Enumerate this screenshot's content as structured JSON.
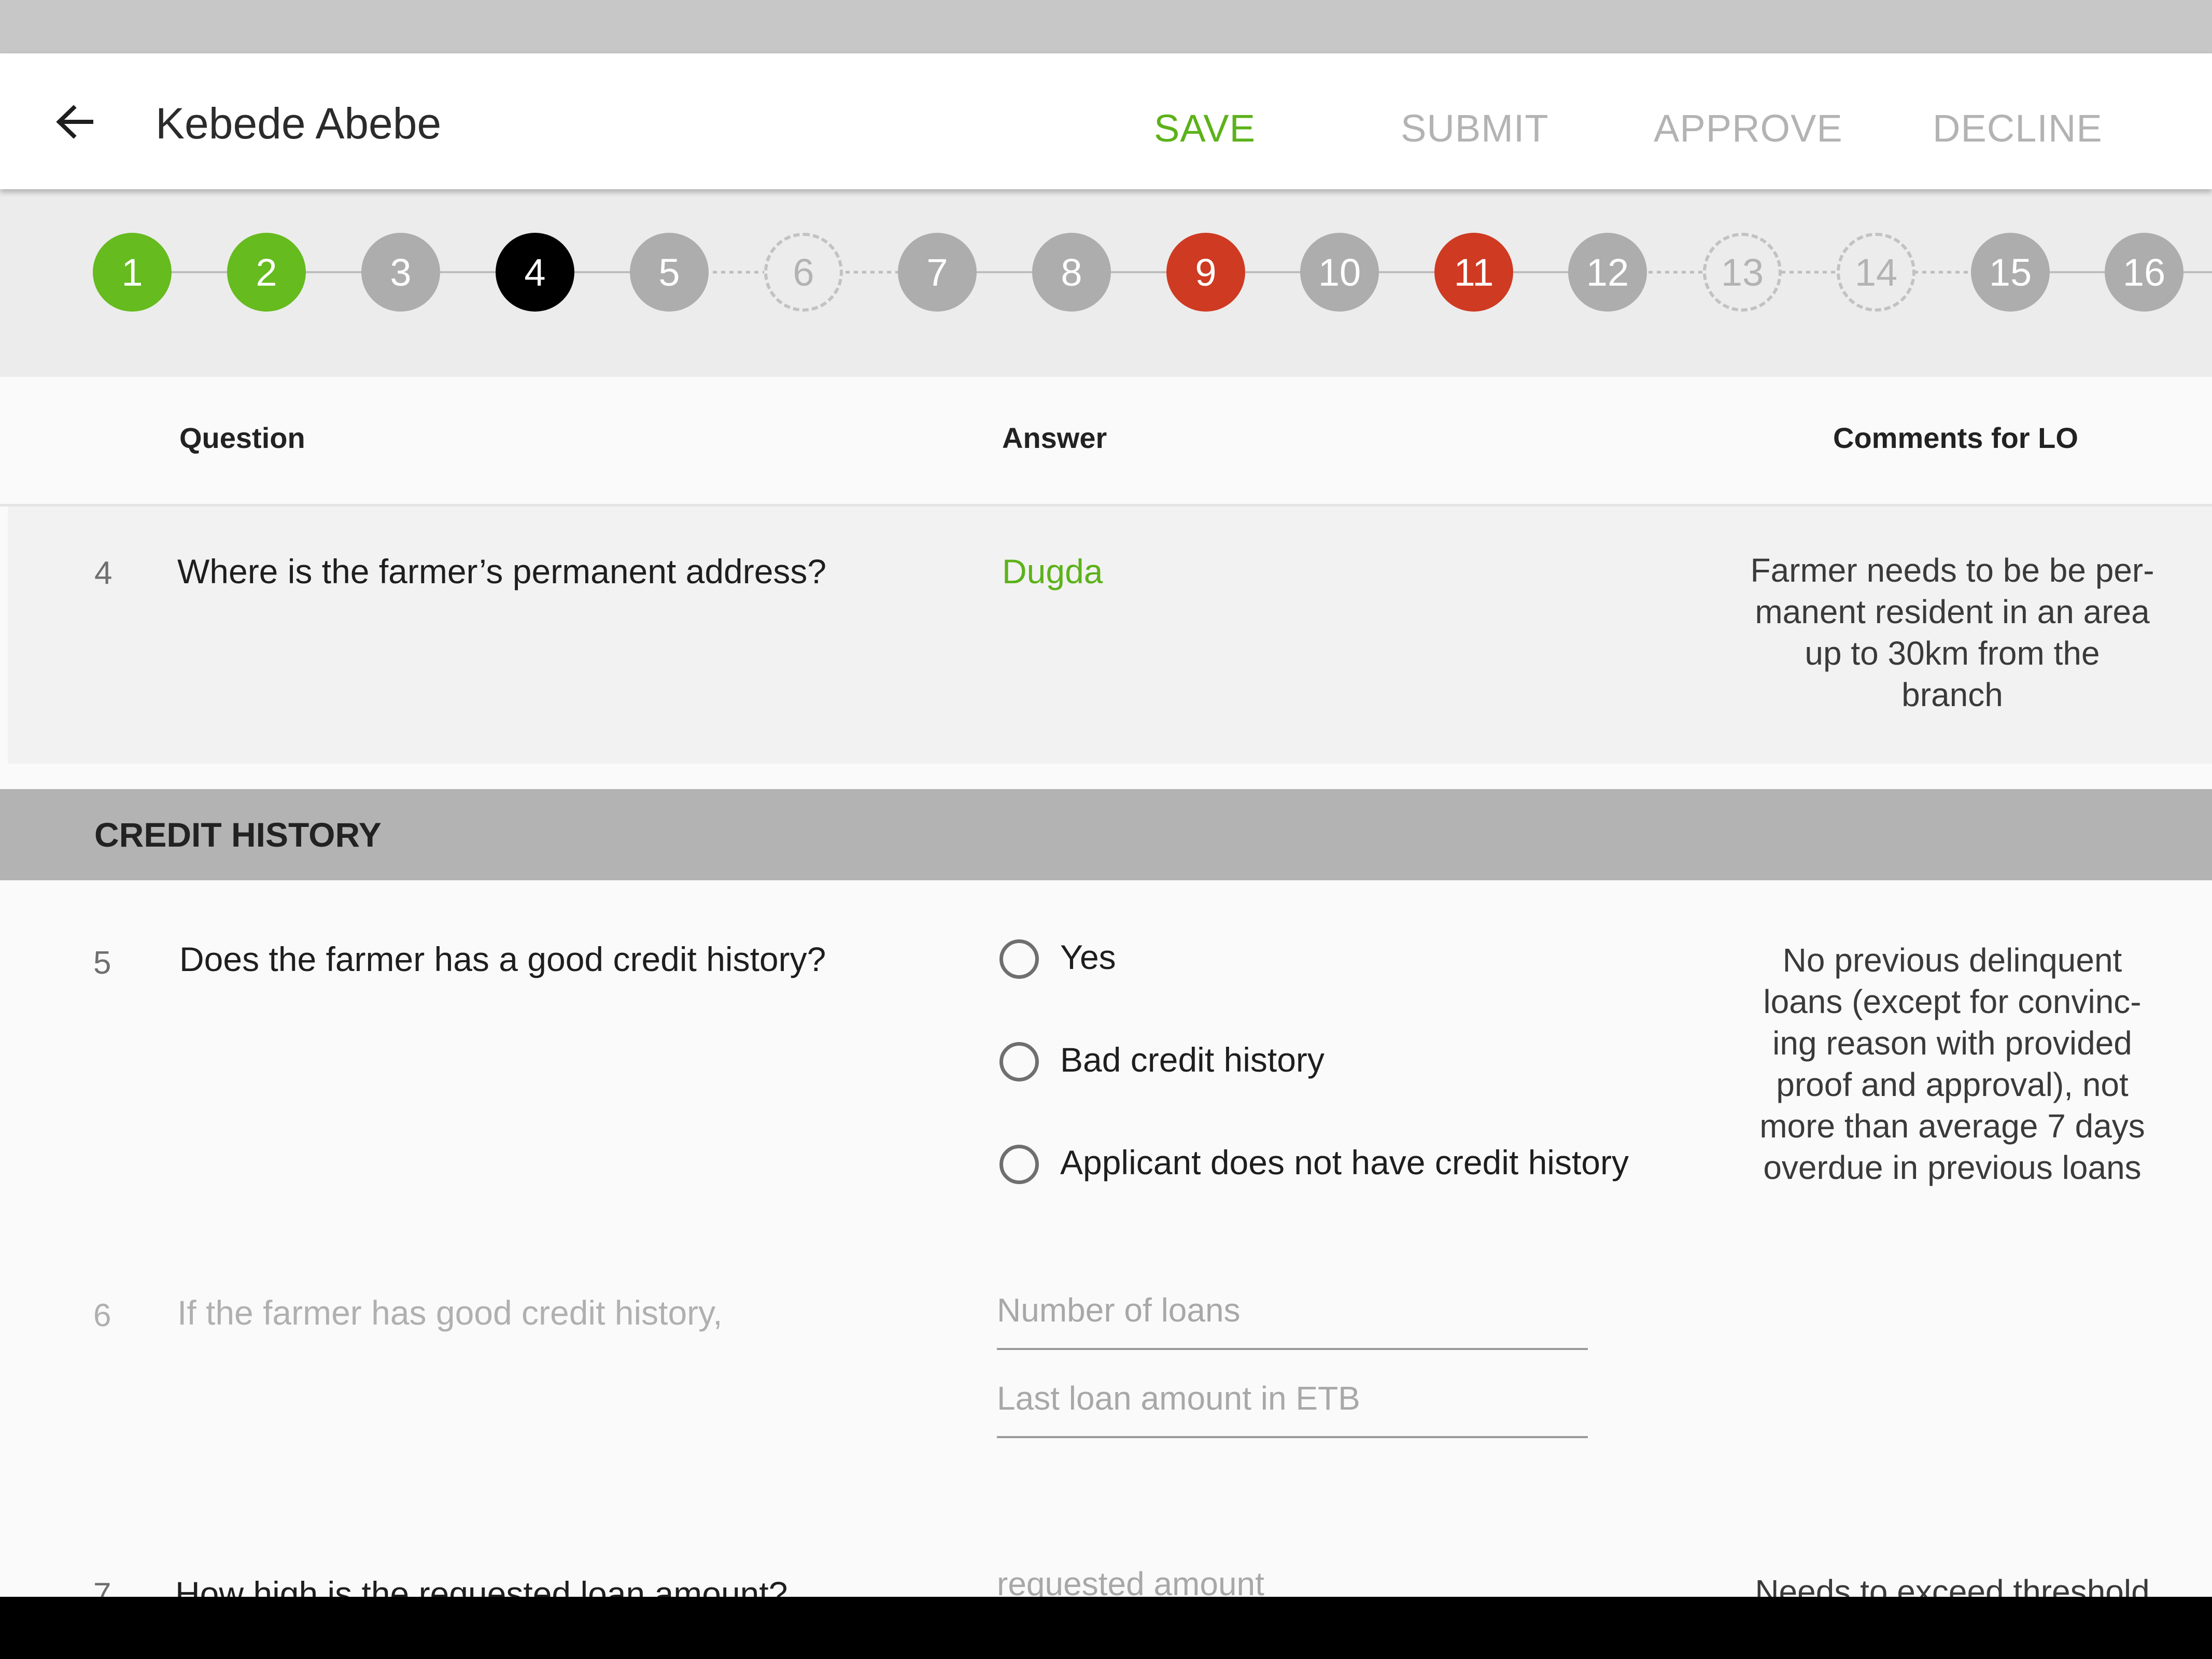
{
  "app_bar": {
    "title": "Kebede Abebe",
    "actions": {
      "save": "SAVE",
      "submit": "SUBMIT",
      "approve": "APPROVE",
      "decline": "DECLINE"
    }
  },
  "stepper": {
    "steps": [
      {
        "label": "1",
        "status": "complete"
      },
      {
        "label": "2",
        "status": "complete"
      },
      {
        "label": "3",
        "status": "pending"
      },
      {
        "label": "4",
        "status": "current"
      },
      {
        "label": "5",
        "status": "pending"
      },
      {
        "label": "6",
        "status": "future"
      },
      {
        "label": "7",
        "status": "pending"
      },
      {
        "label": "8",
        "status": "pending"
      },
      {
        "label": "9",
        "status": "error"
      },
      {
        "label": "10",
        "status": "pending"
      },
      {
        "label": "11",
        "status": "error"
      },
      {
        "label": "12",
        "status": "pending"
      },
      {
        "label": "13",
        "status": "future"
      },
      {
        "label": "14",
        "status": "future"
      },
      {
        "label": "15",
        "status": "pending"
      },
      {
        "label": "16",
        "status": "pending"
      }
    ]
  },
  "table": {
    "headers": {
      "question": "Question",
      "answer": "Answer",
      "comments": "Comments for LO"
    }
  },
  "questions": {
    "q4": {
      "number": "4",
      "text": "Where is the farmer’s permanent address?",
      "answer": "Dugda",
      "comment_lines": [
        "Farmer needs to be be per-",
        "manent resident in an area",
        "up to 30km from the",
        "branch"
      ]
    },
    "section_credit": "CREDIT HISTORY",
    "q5": {
      "number": "5",
      "text": "Does the farmer has a good credit history?",
      "options": [
        "Yes",
        "Bad credit history",
        "Applicant does not have credit history"
      ],
      "comment_lines": [
        "No previous delinquent",
        "loans (except for convinc-",
        "ing reason with provided",
        "proof and approval), not",
        "more than average 7 days",
        "overdue in previous loans"
      ]
    },
    "q6": {
      "number": "6",
      "text": "If the farmer has good credit history,",
      "field1_placeholder": "Number of loans",
      "field2_placeholder": "Last loan amount in ETB"
    },
    "q7": {
      "number": "7",
      "text": "How high is the requested loan amount?",
      "field_placeholder": "requested amount",
      "comment_partial": "Needs to exceed threshold"
    }
  },
  "colors": {
    "complete": "#66bb1e",
    "current": "#000000",
    "pending": "#adadad",
    "error": "#cf3a22",
    "save_accent": "#5cb21a",
    "disabled_action": "#b3b3b3"
  }
}
